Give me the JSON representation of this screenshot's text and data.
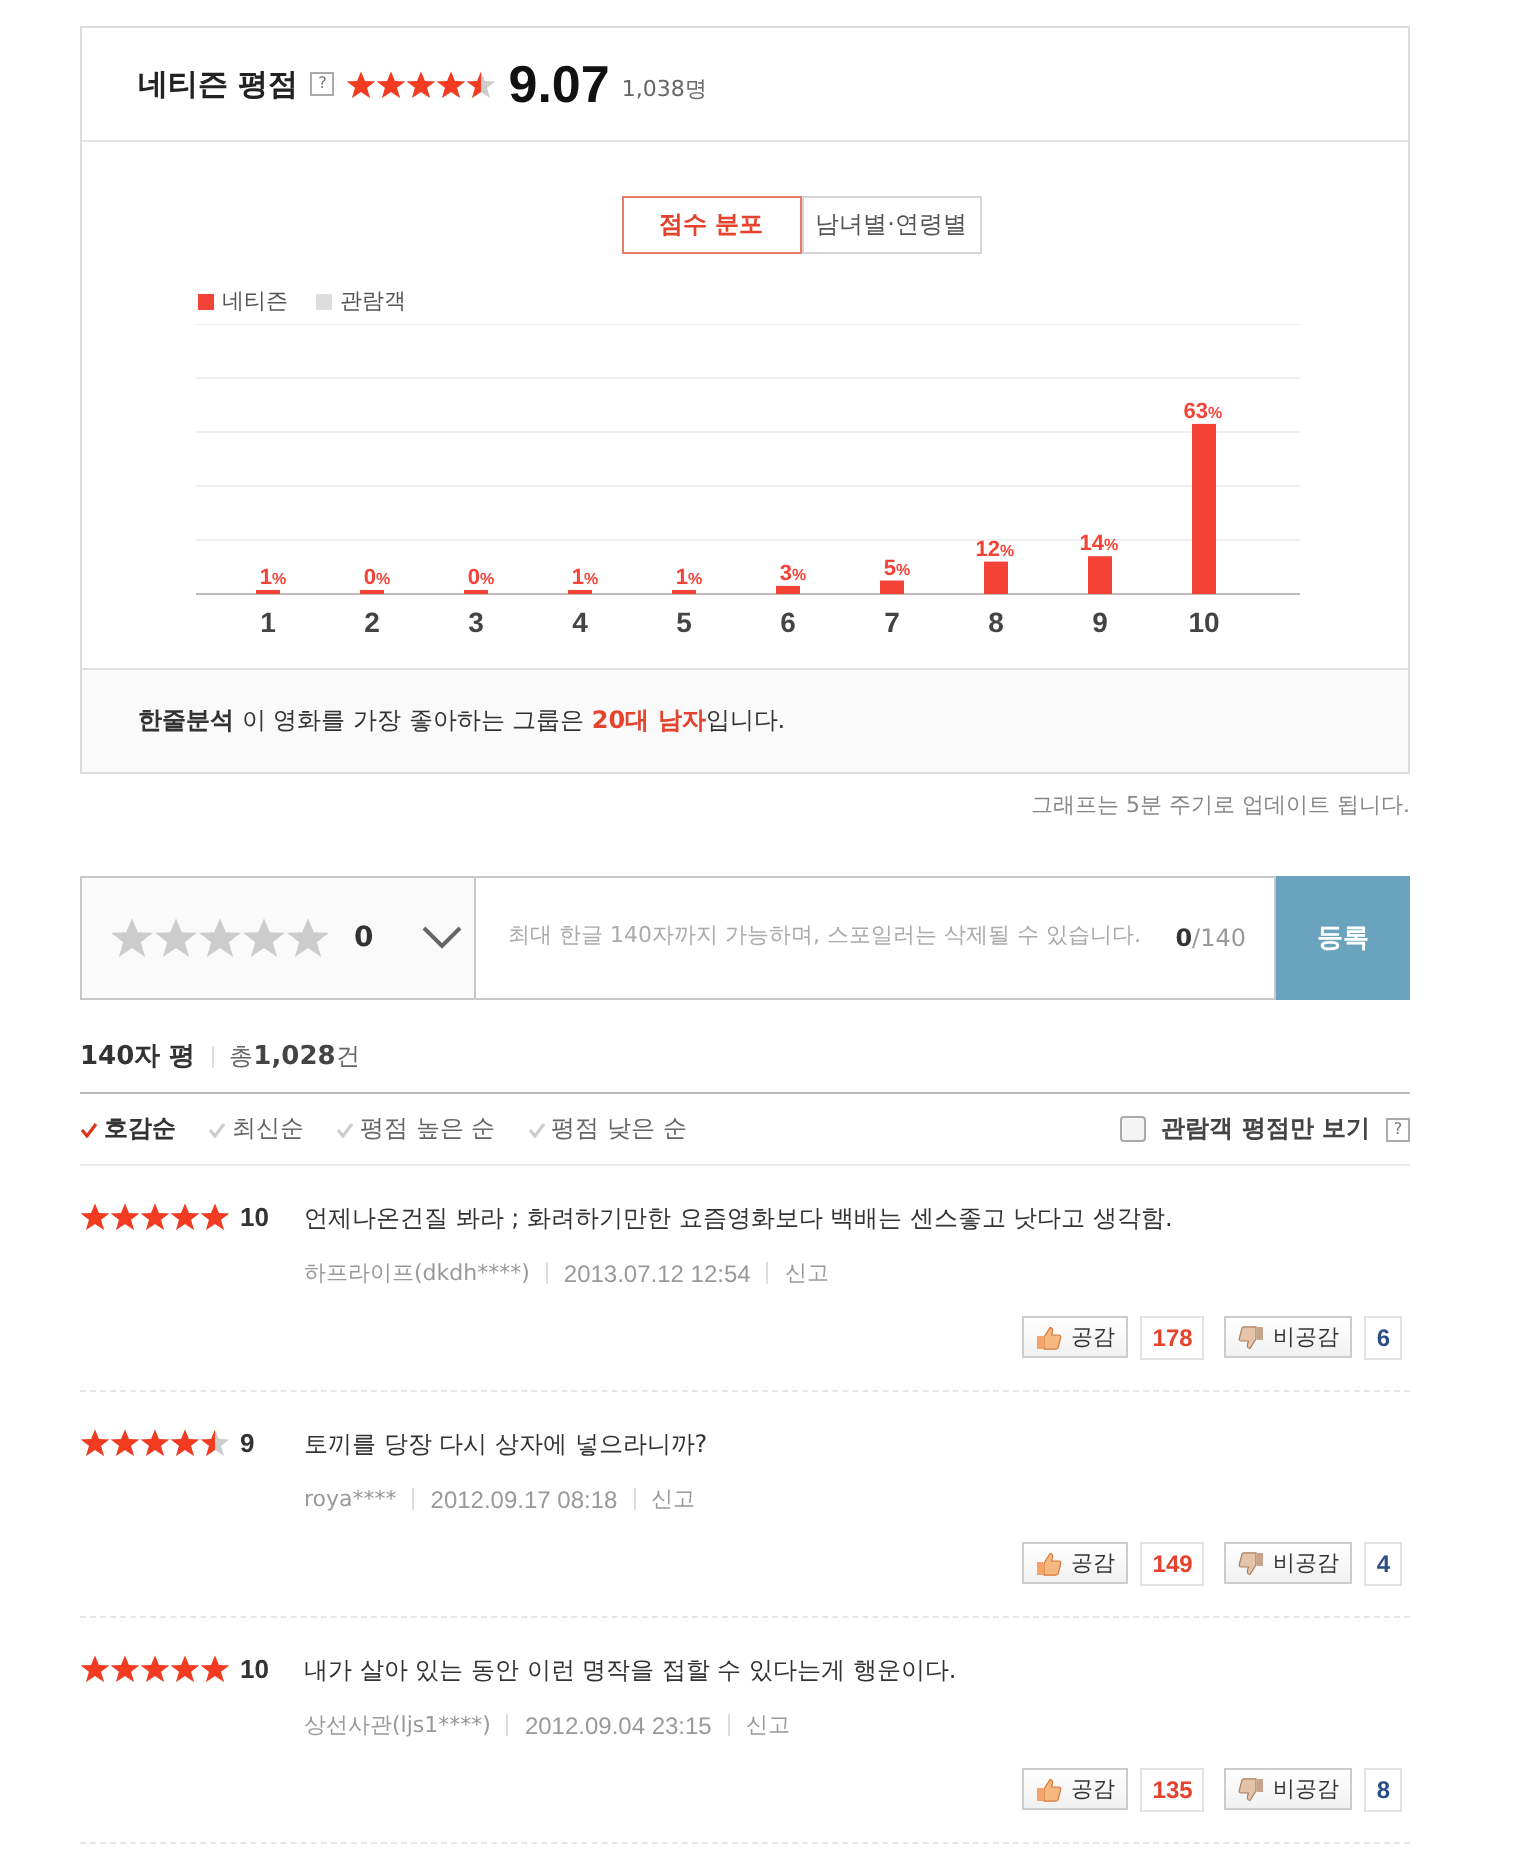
{
  "rating_header": {
    "title": "네티즌 평점",
    "help": "?",
    "stars": 4.5,
    "score": "9.07",
    "count": "1,038명"
  },
  "tabs": [
    {
      "label": "점수 분포",
      "selected": true
    },
    {
      "label": "남녀별·연령별",
      "selected": false
    }
  ],
  "chart_data": {
    "type": "bar",
    "categories": [
      "1",
      "2",
      "3",
      "4",
      "5",
      "6",
      "7",
      "8",
      "9",
      "10"
    ],
    "series": [
      {
        "name": "네티즌",
        "color": "#f44336",
        "values": [
          1,
          0,
          0,
          1,
          1,
          3,
          5,
          12,
          14,
          63
        ]
      },
      {
        "name": "관람객",
        "color": "#dddddd",
        "values": [
          null,
          null,
          null,
          null,
          null,
          null,
          null,
          null,
          null,
          null
        ]
      }
    ],
    "data_labels": true
  },
  "bar_label_unit": "%",
  "analysis": "**한줄분석** 이 영화를 가장 좋아하는 그룹은 **20대 남자**입니다.",
  "update_note": "그래프는 5분 주기로 업데이트 됩니다.",
  "review_form": {
    "stars": 0,
    "rating": "0",
    "placeholder": "최대 한글 140자까지 가능하며, 스포일러는 삭제될 수 있습니다.",
    "counter": "**0**/140",
    "submit": "등록"
  },
  "list_header": {
    "title": "140자 평",
    "total": "총**1,028**건"
  },
  "sort_options": [
    {
      "label": "호감순",
      "selected": true
    },
    {
      "label": "최신순",
      "selected": false
    },
    {
      "label": "평점 높은 순",
      "selected": false
    },
    {
      "label": "평점 낮은 순",
      "selected": false
    }
  ],
  "audience_filter": {
    "label": "관람객 평점만 보기",
    "checked": false,
    "help": "?"
  },
  "reviews": [
    {
      "stars": 5,
      "score": "10",
      "text": "언제나온건질 봐라 ; 화려하기만한 요즘영화보다 백배는 센스좋고 낫다고 생각함.",
      "author": "하프라이프(dkdh****)",
      "date": "2013.07.12 12:54",
      "report": "신고",
      "like_label": "공감",
      "likes": "178",
      "dislike_label": "비공감",
      "dislikes": "6"
    },
    {
      "stars": 4.5,
      "score": "9",
      "text": "토끼를 당장 다시 상자에 넣으라니까?",
      "author": "roya****",
      "date": "2012.09.17 08:18",
      "report": "신고",
      "like_label": "공감",
      "likes": "149",
      "dislike_label": "비공감",
      "dislikes": "4"
    },
    {
      "stars": 5,
      "score": "10",
      "text": "내가 살아 있는 동안 이런 명작을 접할 수 있다는게 행운이다.",
      "author": "상선사관(ljs1****)",
      "date": "2012.09.04 23:15",
      "report": "신고",
      "like_label": "공감",
      "likes": "135",
      "dislike_label": "비공감",
      "dislikes": "8"
    }
  ]
}
